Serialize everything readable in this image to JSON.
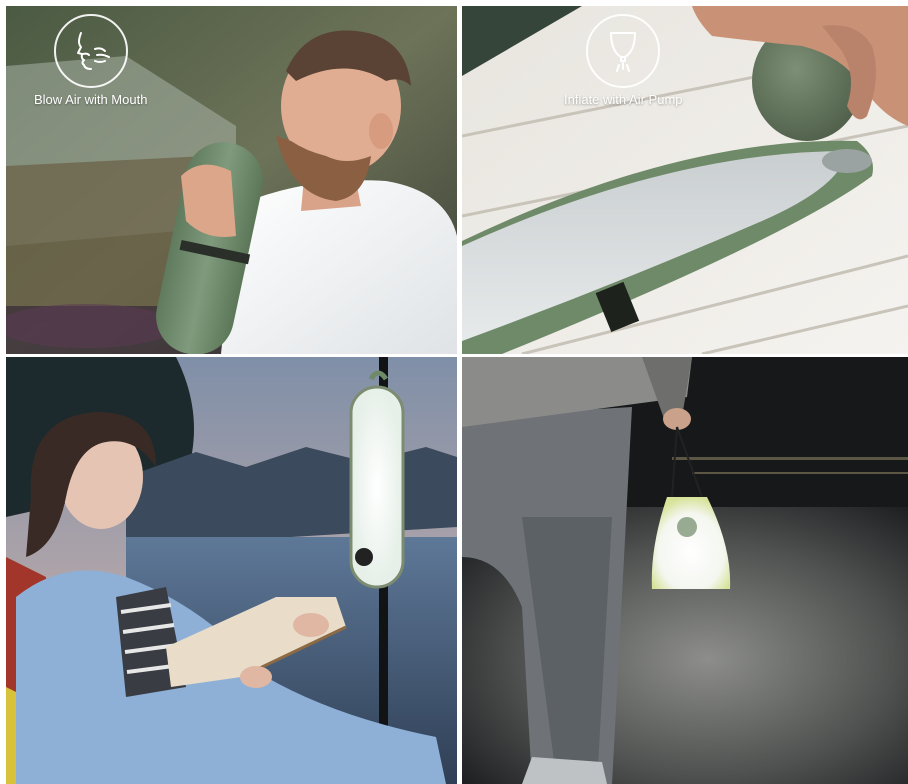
{
  "panels": [
    {
      "caption": "Blow Air with Mouth",
      "icon": "mouth-blowing-icon"
    },
    {
      "caption": "Inflate with Air Pump",
      "icon": "air-pump-icon"
    },
    {
      "caption": "",
      "icon": ""
    },
    {
      "caption": "",
      "icon": ""
    }
  ],
  "colors": {
    "product_green": "#6f8a68",
    "lamp_glow": "#f4f7f2",
    "dusk_sky": "#8fa4c0",
    "night": "#1b1e22"
  }
}
